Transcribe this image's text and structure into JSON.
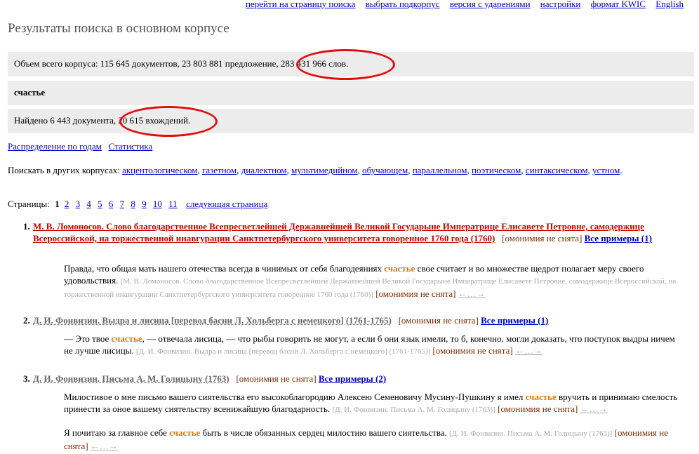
{
  "topnav": [
    "перейти на страницу поиска",
    "выбрать подкорпус",
    "версия с ударениями",
    "настройки",
    "формат KWIC",
    "English"
  ],
  "title": "Результаты поиска в основном корпусе",
  "corpus_stats": {
    "prefix": "Объем всего корпуса: 115 645 документов, 23 803 881 предложение, ",
    "circled": "283 431 966 слов."
  },
  "query": "счастье",
  "found": {
    "prefix": "Найдено 6 443 документа, ",
    "circled": "20 615 вхождений."
  },
  "links": {
    "distribution": "Распределение по годам",
    "statistics": "Статистика"
  },
  "other_corpora": {
    "label": "Поискать в других корпусах:",
    "items": [
      "акцентологическом",
      "газетном",
      "диалектном",
      "мультимедийном",
      "обучающем",
      "параллельном",
      "поэтическом",
      "синтаксическом",
      "устном"
    ]
  },
  "pagination": {
    "label": "Страницы:",
    "current": "1",
    "pages": [
      "2",
      "3",
      "4",
      "5",
      "6",
      "7",
      "8",
      "9",
      "10",
      "11"
    ],
    "next": "следующая страница"
  },
  "homonymy": "[омонимия не снята]",
  "arrows": "←…→",
  "docs": [
    {
      "num": "1.",
      "title": "М. В. Ломоносов. Слово благодарственное Всепресветлейшей Державнейшей Великой Государыне Императрице Елисавете Петровне, самодержице Всероссийской, на торжественной инавгурации Санктпетербургского университета говоренное 1760 года (1760)",
      "all_examples": "Все примеры (1)",
      "snippets": [
        {
          "before": "Правда, что общая мать нашего отечества всегда в чинимых от себя благодеяниях ",
          "hit": "счастье",
          "after": " свое считает и во множестве щедрот полагает меру своего удовольствия.",
          "source": "[М. В. Ломоносов. Слово благодарственное Всепресветлейшей Державнейшей Великой Государыне Императрице Елисавете Петровне, самодержице Всероссийской, на торжественной инавгурации Санктпетербургского университета говоренное 1760 года (1760)]"
        }
      ]
    },
    {
      "num": "2.",
      "title": "Д. И. Фонвизин. Выдра и лисица [перевод басни Л. Хольберга с немецкого] (1761-1765)",
      "all_examples": "Все примеры (1)",
      "snippets": [
        {
          "before": "— Это твое ",
          "hit": "счастье",
          "after": ", — отвечала лисица, — что рыбы говорить не могут, а если б они язык имели, то б, конечно, могли доказать, что поступок выдры ничем не лучше лисицы.",
          "source": "[Д. И. Фонвизин. Выдра и лисица [перевод басни Л. Хольберга с немецкого] (1761-1765)]"
        }
      ]
    },
    {
      "num": "3.",
      "title": "Д. И. Фонвизин. Письма А. М. Голицыну (1763)",
      "all_examples": "Все примеры (2)",
      "snippets": [
        {
          "before": "Милостивое о мне письмо вашего сиятельства его высокоблагородию Алексею Семеновичу Мусину-Пушкину я имел ",
          "hit": "счастье",
          "after": " вручить и принимаю смелость принести за оное вашему сиятельству всенижайшую благодарность.",
          "source": "[Д. И. Фонвизин. Письма А. М. Голицыну (1763)]"
        },
        {
          "before": "Я почитаю за главное себе ",
          "hit": "счастье",
          "after": " быть в числе обязанных сердец милостию вашего сиятельства.",
          "source": "[Д. И. Фонвизин. Письма А. М. Голицыну (1763)]"
        }
      ]
    }
  ]
}
